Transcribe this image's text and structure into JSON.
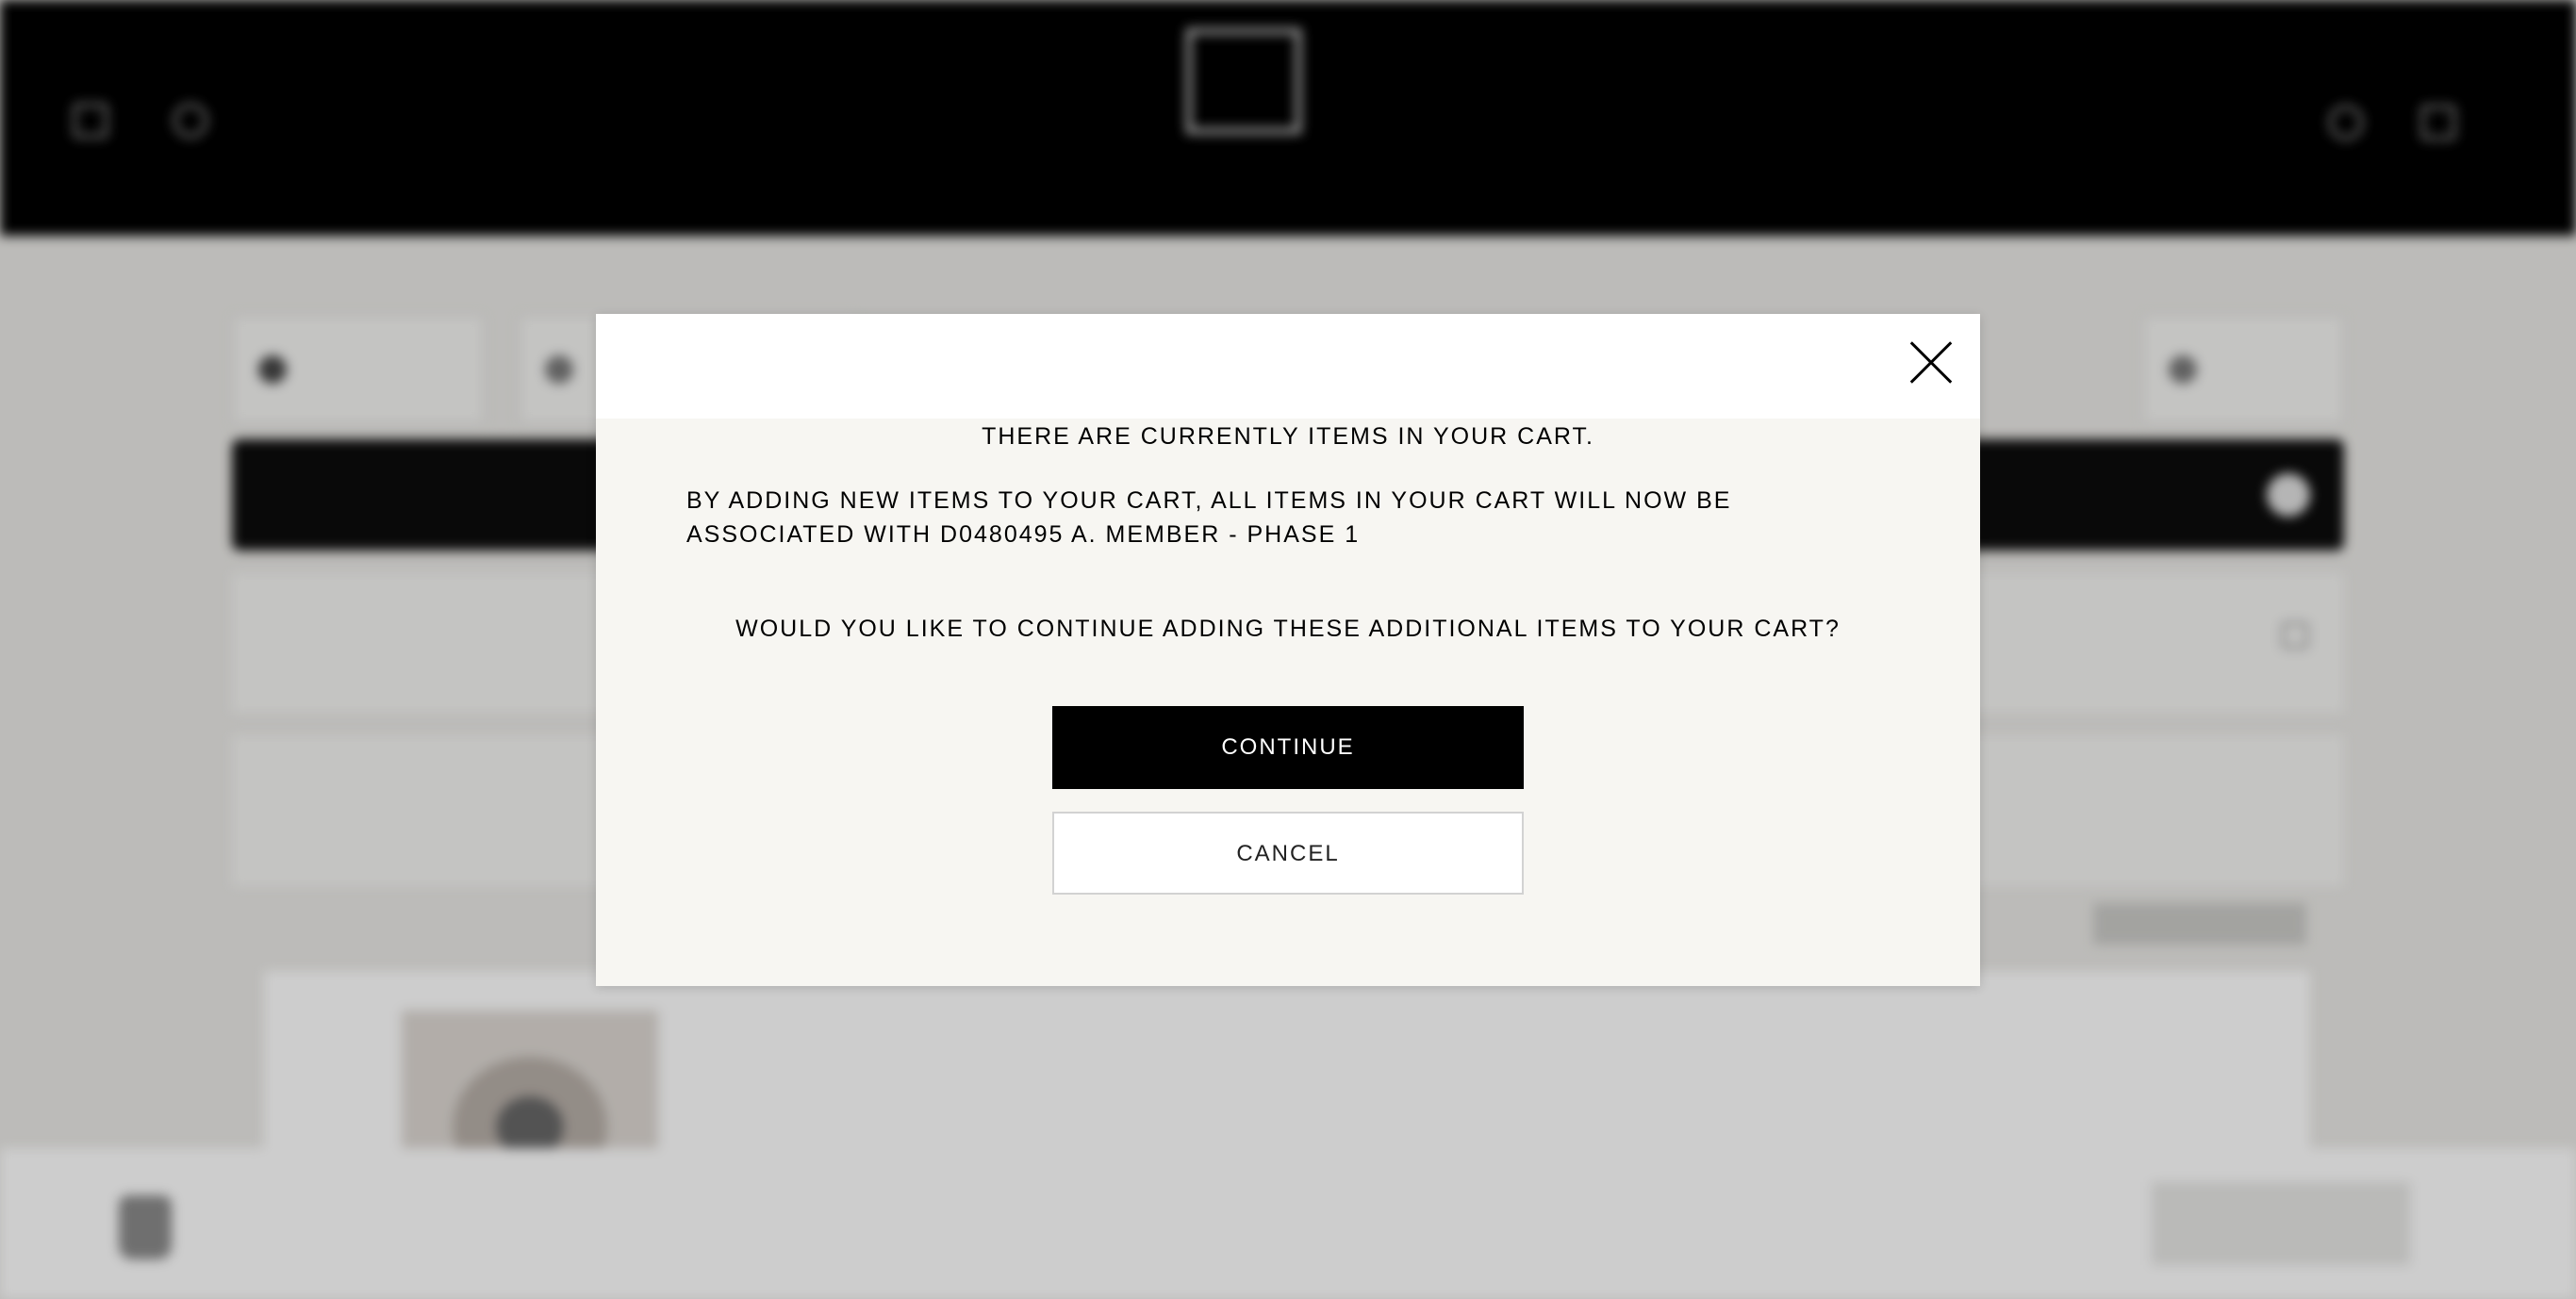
{
  "modal": {
    "line1": "THERE ARE CURRENTLY ITEMS IN YOUR CART.",
    "line2": "BY ADDING NEW ITEMS TO YOUR CART, ALL ITEMS IN YOUR CART WILL NOW BE ASSOCIATED WITH D0480495 A. MEMBER - PHASE 1",
    "line3": "WOULD YOU LIKE TO CONTINUE ADDING THESE ADDITIONAL ITEMS TO YOUR CART?",
    "continue_label": "CONTINUE",
    "cancel_label": "CANCEL",
    "close_icon": "close-icon"
  },
  "background": {
    "header": {
      "promo": "",
      "logo": "",
      "nav_items": [
        "",
        "",
        "",
        "",
        "",
        "",
        "",
        "",
        "",
        "",
        "",
        "",
        "",
        ""
      ],
      "cart_count": ""
    },
    "toolbar": {
      "settings_label": "",
      "print_label": ""
    },
    "bar": {
      "title": "",
      "right_label": ""
    },
    "project": {
      "name": "",
      "gallery": "",
      "price": "",
      "price_note": ""
    },
    "section_label": "",
    "row_label": "",
    "pill_label": "",
    "item": {
      "number": "",
      "title": "",
      "subtitle": "",
      "status": "",
      "price": ""
    },
    "bottom": {
      "label": "",
      "totals": [
        "",
        "",
        ""
      ]
    }
  },
  "colors": {
    "overlay": "#000000",
    "modal_bg": "#f7f6f2",
    "primary_button": "#000000",
    "status_gold": "#c8a44a"
  }
}
